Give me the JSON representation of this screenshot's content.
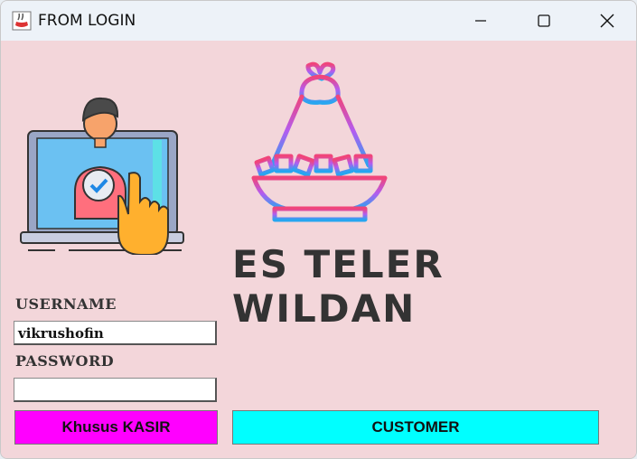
{
  "window": {
    "title": "FROM LOGIN",
    "icons": {
      "app": "java-cup-icon",
      "minimize": "minimize-icon",
      "maximize": "maximize-icon",
      "close": "close-icon"
    }
  },
  "brand": {
    "name": "ES TELER WILDAN",
    "illustrations": [
      "laptop-login-user-illustration",
      "es-teler-dessert-bowl-icon"
    ]
  },
  "form": {
    "username_label": "USERNAME",
    "username_value": "vikrushofin",
    "password_label": "PASSWORD",
    "password_value": ""
  },
  "buttons": {
    "kasir_label": "Khusus KASIR",
    "customer_label": "CUSTOMER"
  },
  "colors": {
    "background": "#f3d6da",
    "kasir": "#ff00ff",
    "customer": "#00ffff"
  }
}
